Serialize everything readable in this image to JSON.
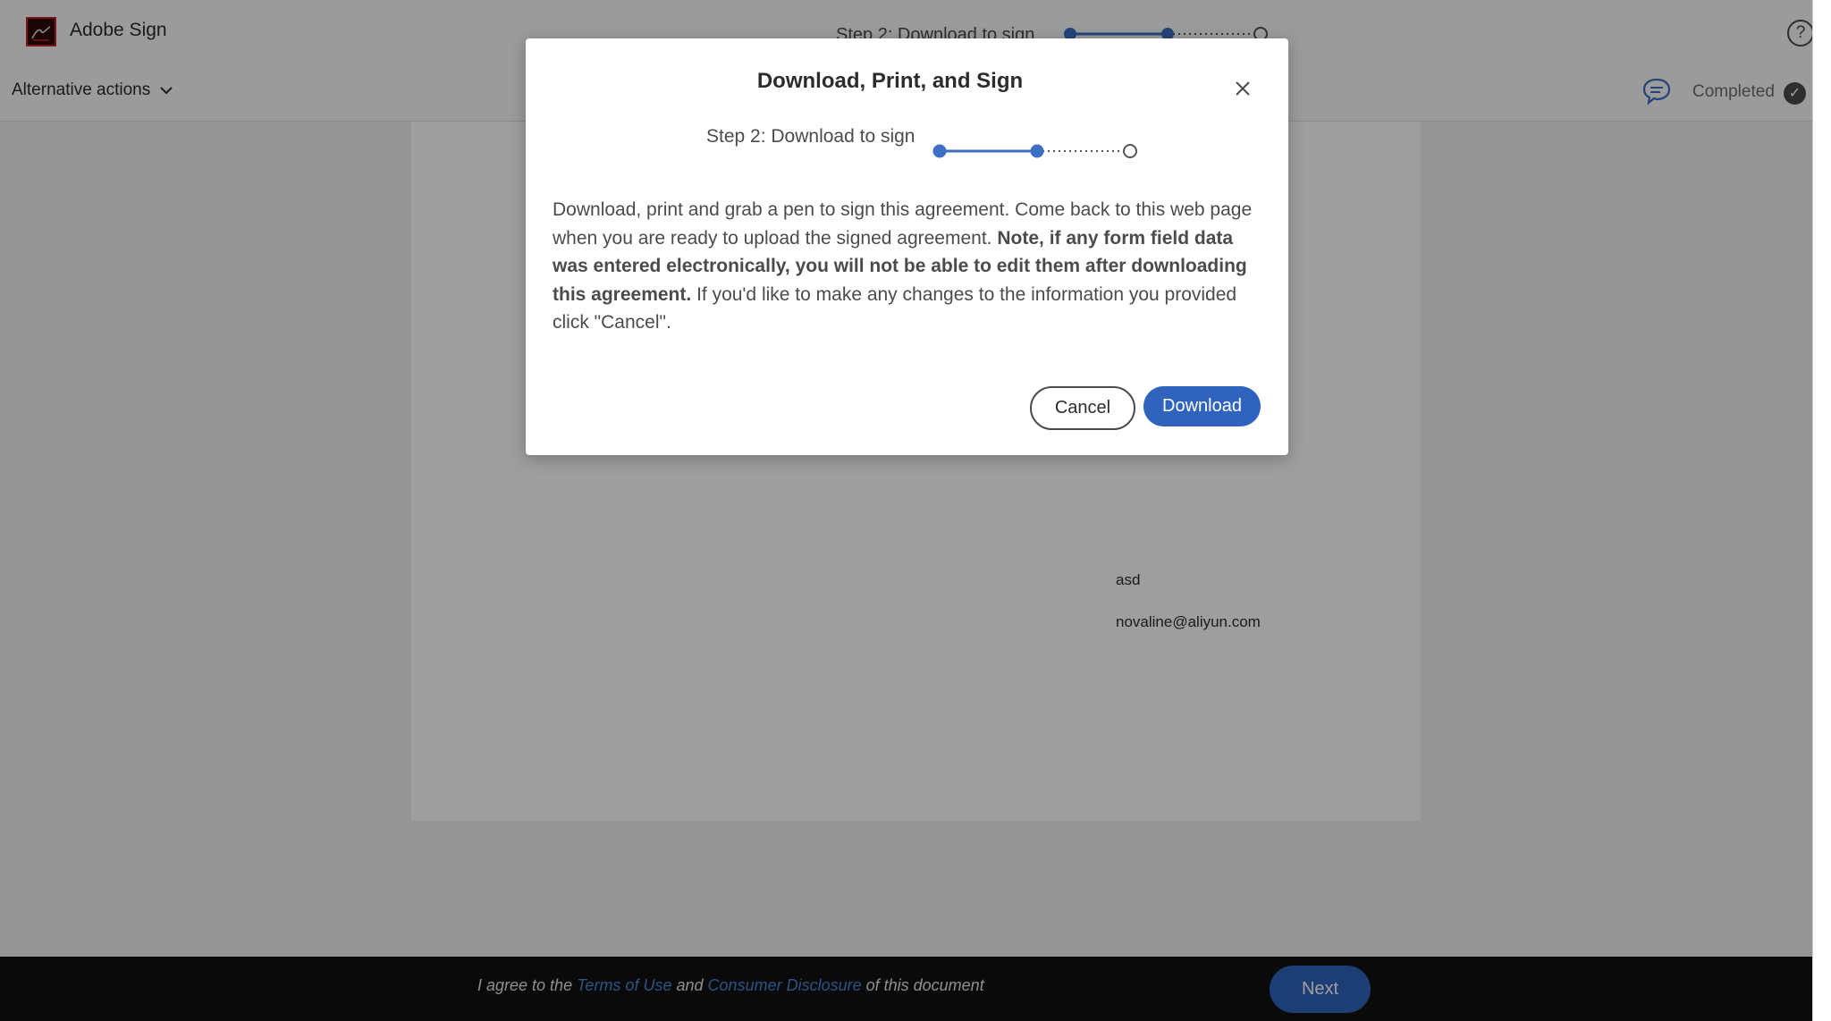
{
  "header": {
    "app_title": "Adobe Sign",
    "step_label": "Step 2: Download to sign",
    "alt_actions_label": "Alternative actions",
    "completed_label": "Completed",
    "help_glyph": "?"
  },
  "document": {
    "line1": "asd",
    "line2": "novaline@aliyun.com"
  },
  "footer": {
    "agree_prefix": "I agree to the",
    "terms_link": "Terms of Use",
    "and_text": "and",
    "disclosure_link": "Consumer Disclosure",
    "agree_suffix": "of this document",
    "next_label": "Next"
  },
  "modal": {
    "title": "Download, Print, and Sign",
    "step_label": "Step 2: Download to sign",
    "body_text_1": "Download, print and grab a pen to sign this agreement. Come back to this web page when you are ready to upload the signed agreement.",
    "body_bold": "Note, if any form field data was entered electronically, you will not be able to edit them after downloading this agreement.",
    "body_text_2": "If you'd like to make any changes to the information you provided click \"Cancel\".",
    "cancel_label": "Cancel",
    "download_label": "Download"
  },
  "progress": {
    "step": 2,
    "total_steps": 3
  },
  "icons": {
    "logo": "adobe-sign-logo",
    "help": "help-icon",
    "chevron": "chevron-down-icon",
    "chat": "chat-bubble-icon",
    "completed": "checkmark-icon",
    "close": "close-icon"
  },
  "colors": {
    "accent": "#2f63bd",
    "progress": "#3d6fc4",
    "footer_bg": "#111111",
    "link": "#4a86d6"
  }
}
